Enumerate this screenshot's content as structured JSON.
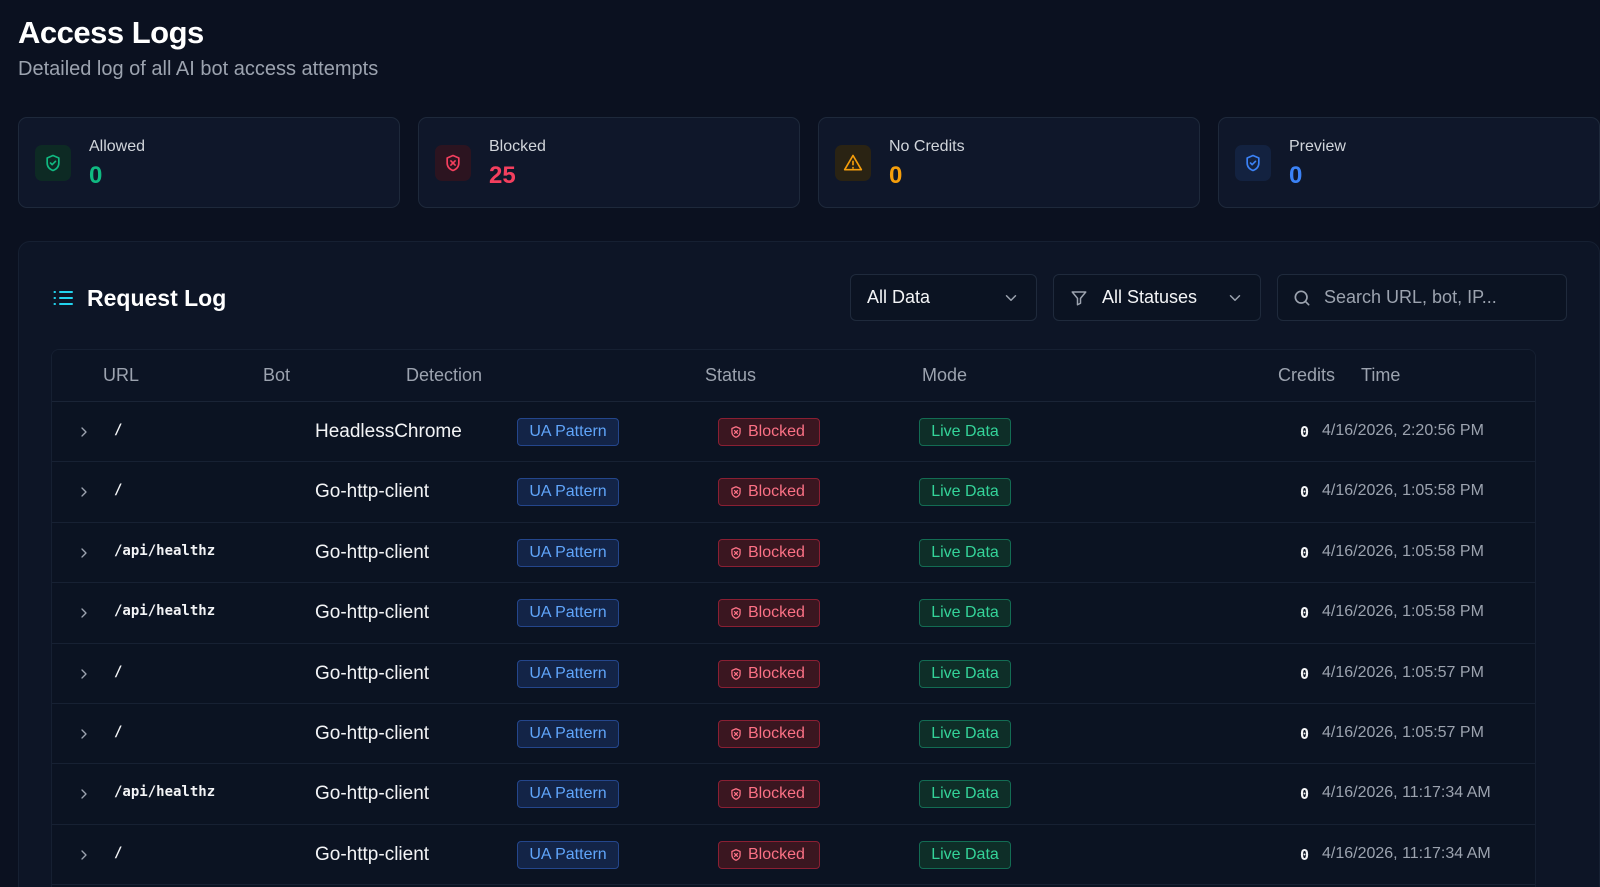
{
  "header": {
    "title": "Access Logs",
    "subtitle": "Detailed log of all AI bot access attempts"
  },
  "stats": [
    {
      "label": "Allowed",
      "value": "0",
      "color": "#10b981",
      "icon": "shield-check-icon"
    },
    {
      "label": "Blocked",
      "value": "25",
      "color": "#f43f5e",
      "icon": "shield-x-icon"
    },
    {
      "label": "No Credits",
      "value": "0",
      "color": "#f59e0b",
      "icon": "warning-icon"
    },
    {
      "label": "Preview",
      "value": "0",
      "color": "#3b82f6",
      "icon": "shield-check-icon"
    }
  ],
  "panel": {
    "title": "Request Log",
    "data_filter": "All Data",
    "status_filter": "All Statuses",
    "search_placeholder": "Search URL, bot, IP..."
  },
  "table": {
    "columns": {
      "url": "URL",
      "bot": "Bot",
      "detection": "Detection",
      "status": "Status",
      "mode": "Mode",
      "credits": "Credits",
      "time": "Time"
    },
    "rows": [
      {
        "url": "/",
        "bot": "HeadlessChrome",
        "detection": "UA Pattern",
        "status": "Blocked",
        "mode": "Live Data",
        "credits": "0",
        "time": "4/16/2026, 2:20:56 PM"
      },
      {
        "url": "/",
        "bot": "Go-http-client",
        "detection": "UA Pattern",
        "status": "Blocked",
        "mode": "Live Data",
        "credits": "0",
        "time": "4/16/2026, 1:05:58 PM"
      },
      {
        "url": "/api/healthz",
        "bot": "Go-http-client",
        "detection": "UA Pattern",
        "status": "Blocked",
        "mode": "Live Data",
        "credits": "0",
        "time": "4/16/2026, 1:05:58 PM"
      },
      {
        "url": "/api/healthz",
        "bot": "Go-http-client",
        "detection": "UA Pattern",
        "status": "Blocked",
        "mode": "Live Data",
        "credits": "0",
        "time": "4/16/2026, 1:05:58 PM"
      },
      {
        "url": "/",
        "bot": "Go-http-client",
        "detection": "UA Pattern",
        "status": "Blocked",
        "mode": "Live Data",
        "credits": "0",
        "time": "4/16/2026, 1:05:57 PM"
      },
      {
        "url": "/",
        "bot": "Go-http-client",
        "detection": "UA Pattern",
        "status": "Blocked",
        "mode": "Live Data",
        "credits": "0",
        "time": "4/16/2026, 1:05:57 PM"
      },
      {
        "url": "/api/healthz",
        "bot": "Go-http-client",
        "detection": "UA Pattern",
        "status": "Blocked",
        "mode": "Live Data",
        "credits": "0",
        "time": "4/16/2026, 11:17:34 AM"
      },
      {
        "url": "/",
        "bot": "Go-http-client",
        "detection": "UA Pattern",
        "status": "Blocked",
        "mode": "Live Data",
        "credits": "0",
        "time": "4/16/2026, 11:17:34 AM"
      }
    ]
  }
}
